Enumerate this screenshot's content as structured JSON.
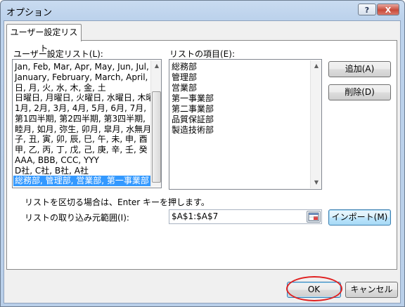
{
  "window": {
    "title": "オプション",
    "help_glyph": "?",
    "close_glyph": "X"
  },
  "tab": {
    "label": "ユーザー設定リスト"
  },
  "custom_lists": {
    "label": "ユーザー設定リスト(L):",
    "items": [
      "Jan, Feb, Mar, Apr, May, Jun, Jul,",
      "January, February, March, April,",
      "日, 月, 火, 水, 木, 金, 土",
      "日曜日, 月曜日, 火曜日, 水曜日, 木曜",
      "1月, 2月, 3月, 4月, 5月, 6月, 7月,",
      "第1四半期, 第2四半期, 第3四半期,",
      "睦月, 如月, 弥生, 卯月, 皐月, 水無月",
      "子, 丑, 寅, 卯, 辰, 巳, 午, 未, 申, 酉",
      "甲, 乙, 丙, 丁, 戊, 己, 庚, 辛, 壬, 癸",
      "AAA, BBB, CCC, YYY",
      "D社, C社, B社, A社",
      "総務部, 管理部, 営業部, 第一事業部"
    ],
    "selected_index": 11
  },
  "list_entries": {
    "label": "リストの項目(E):",
    "items": [
      "総務部",
      "管理部",
      "営業部",
      "第一事業部",
      "第二事業部",
      "品質保証部",
      "製造技術部"
    ]
  },
  "buttons": {
    "add": "追加(A)",
    "delete": "削除(D)",
    "import": "インポート(M)",
    "ok": "OK",
    "cancel": "キャンセル"
  },
  "hint_text": "リストを区切る場合は、Enter キーを押します。",
  "import_range": {
    "label": "リストの取り込み元範囲(I):",
    "value": "$A$1:$A$7"
  },
  "colors": {
    "selection": "#3399ff",
    "annotation_circle": "#e02020"
  }
}
